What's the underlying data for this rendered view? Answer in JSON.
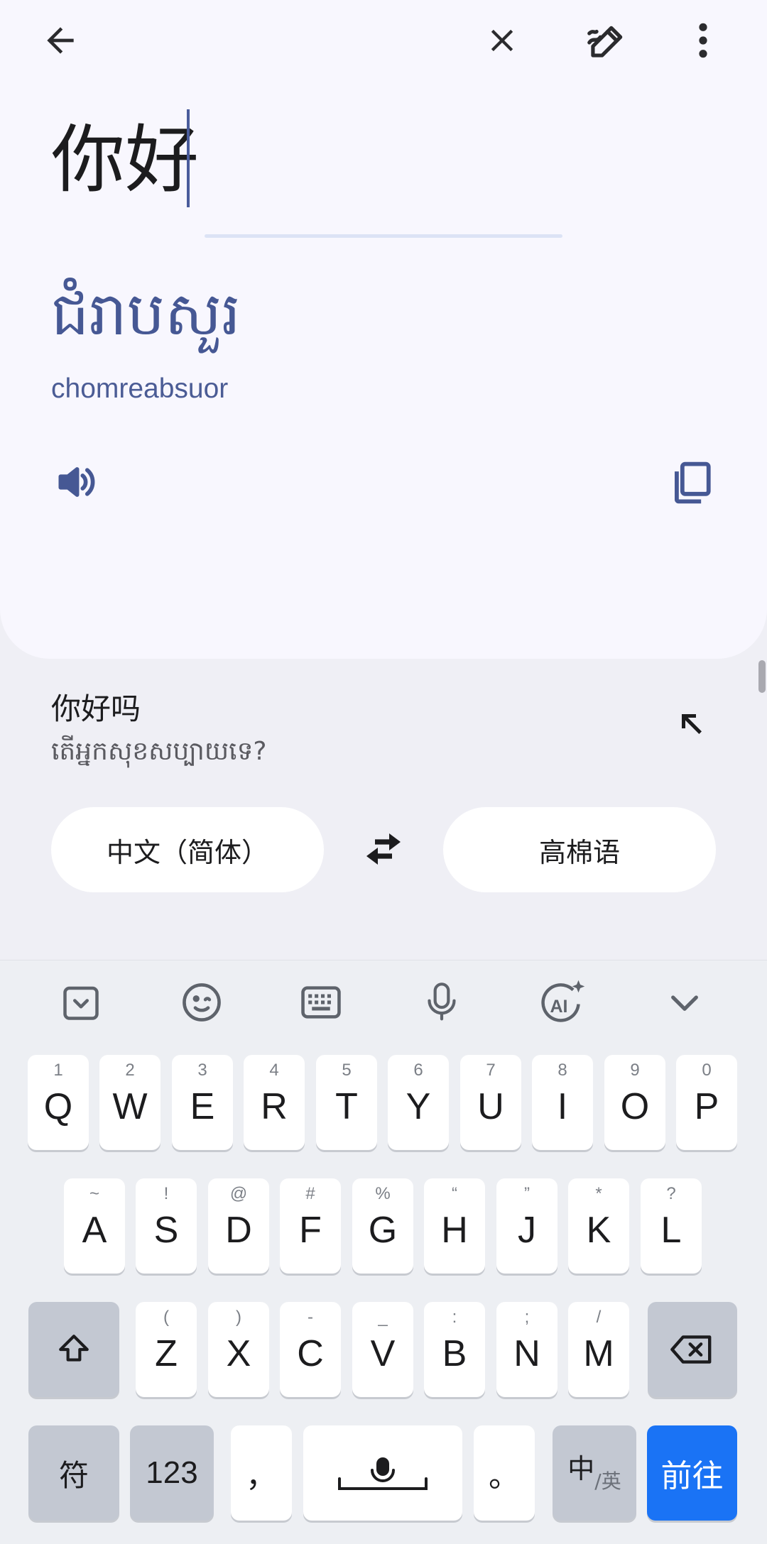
{
  "source": {
    "text": "你好"
  },
  "translation": {
    "text": "ជំរាបសួរ",
    "romanization": "chomreabsuor"
  },
  "suggestion": {
    "text": "你好吗",
    "translation": "តើអ្នកសុខសប្បាយទេ?"
  },
  "languages": {
    "source": "中文（简体）",
    "target": "高棉语"
  },
  "keyboard": {
    "row1": [
      {
        "main": "Q",
        "hint": "1"
      },
      {
        "main": "W",
        "hint": "2"
      },
      {
        "main": "E",
        "hint": "3"
      },
      {
        "main": "R",
        "hint": "4"
      },
      {
        "main": "T",
        "hint": "5"
      },
      {
        "main": "Y",
        "hint": "6"
      },
      {
        "main": "U",
        "hint": "7"
      },
      {
        "main": "I",
        "hint": "8"
      },
      {
        "main": "O",
        "hint": "9"
      },
      {
        "main": "P",
        "hint": "0"
      }
    ],
    "row2": [
      {
        "main": "A",
        "hint": "~"
      },
      {
        "main": "S",
        "hint": "!"
      },
      {
        "main": "D",
        "hint": "@"
      },
      {
        "main": "F",
        "hint": "#"
      },
      {
        "main": "G",
        "hint": "%"
      },
      {
        "main": "H",
        "hint": "“"
      },
      {
        "main": "J",
        "hint": "”"
      },
      {
        "main": "K",
        "hint": "*"
      },
      {
        "main": "L",
        "hint": "?"
      }
    ],
    "row3": [
      {
        "main": "Z",
        "hint": "("
      },
      {
        "main": "X",
        "hint": ")"
      },
      {
        "main": "C",
        "hint": "-"
      },
      {
        "main": "V",
        "hint": "_"
      },
      {
        "main": "B",
        "hint": ":"
      },
      {
        "main": "N",
        "hint": ";"
      },
      {
        "main": "M",
        "hint": "/"
      }
    ],
    "symbols_label": "符",
    "numbers_label": "123",
    "comma_label": "，",
    "period_label": "。",
    "lang_toggle_main": "中",
    "lang_toggle_sub": "/英",
    "go_label": "前往"
  }
}
